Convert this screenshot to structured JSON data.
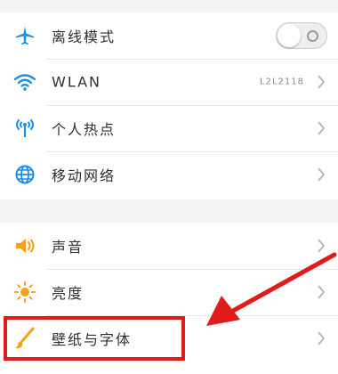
{
  "settings": {
    "group1": [
      {
        "label": "离线模式",
        "icon": "airplane-icon",
        "control": "toggle",
        "toggle_on": false
      },
      {
        "label": "WLAN",
        "icon": "wifi-icon",
        "value": "L2L2118"
      },
      {
        "label": "个人热点",
        "icon": "hotspot-icon"
      },
      {
        "label": "移动网络",
        "icon": "globe-icon"
      }
    ],
    "group2": [
      {
        "label": "声音",
        "icon": "speaker-icon"
      },
      {
        "label": "亮度",
        "icon": "sun-icon"
      },
      {
        "label": "壁纸与字体",
        "icon": "brush-icon"
      }
    ]
  },
  "colors": {
    "accent_blue": "#1a8fe6",
    "accent_orange": "#f5a21b",
    "annotation_red": "#e11b1b"
  }
}
